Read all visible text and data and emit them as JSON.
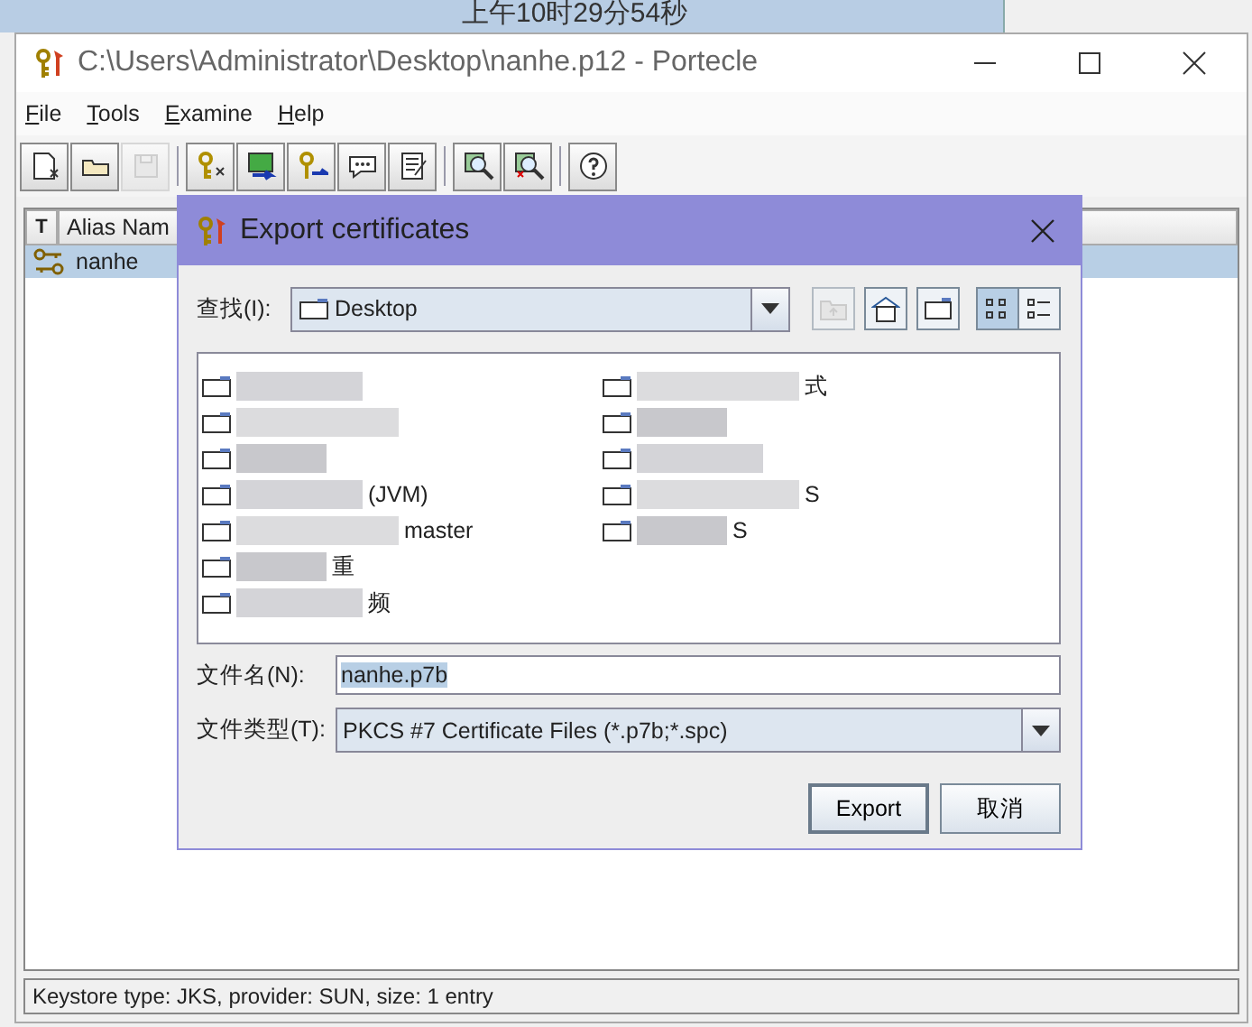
{
  "background_window": {
    "clock_text": "上午10时29分54秒"
  },
  "window": {
    "title": "C:\\Users\\Administrator\\Desktop\\nanhe.p12 - Portecle"
  },
  "menu": [
    {
      "label": "File"
    },
    {
      "label": "Tools"
    },
    {
      "label": "Examine"
    },
    {
      "label": "Help"
    }
  ],
  "toolbar": [
    [
      {
        "kind": "new",
        "disabled": false
      },
      {
        "kind": "open",
        "disabled": false
      },
      {
        "kind": "save",
        "disabled": true
      }
    ],
    [
      {
        "kind": "key",
        "disabled": false
      },
      {
        "kind": "import",
        "disabled": false
      },
      {
        "kind": "keyimport",
        "disabled": false
      },
      {
        "kind": "chat",
        "disabled": false
      },
      {
        "kind": "report",
        "disabled": false
      }
    ],
    [
      {
        "kind": "examine",
        "disabled": false
      },
      {
        "kind": "examinex",
        "disabled": false
      }
    ],
    [
      {
        "kind": "help",
        "disabled": false
      }
    ]
  ],
  "table": {
    "columns": [
      {
        "label": "T"
      },
      {
        "label": "Alias Nam"
      }
    ],
    "rows": [
      {
        "alias": "nanhe",
        "selected": true
      }
    ]
  },
  "dialog": {
    "title": "Export certificates",
    "look_in": {
      "label": "查找(I):",
      "value": "Desktop"
    },
    "nav_buttons": [
      {
        "kind": "up",
        "disabled": true,
        "selected": false
      },
      {
        "kind": "home",
        "disabled": false,
        "selected": false
      },
      {
        "kind": "newfolder",
        "disabled": false,
        "selected": false
      },
      {
        "kind": "list",
        "disabled": false,
        "selected": true
      },
      {
        "kind": "details",
        "disabled": false,
        "selected": false
      }
    ],
    "files": [
      [
        {
          "kind": "folder"
        },
        {
          "kind": "folder"
        },
        {
          "kind": "folder"
        },
        {
          "kind": "folder",
          "text": "(JVM)"
        },
        {
          "kind": "folder",
          "text": "master"
        },
        {
          "kind": "folder",
          "text": "重"
        },
        {
          "kind": "folder",
          "text": "频"
        }
      ],
      [
        {
          "kind": "folder",
          "text": "式"
        },
        {
          "kind": "folder"
        },
        {
          "kind": "folder"
        },
        {
          "kind": "folder",
          "text": "S"
        },
        {
          "kind": "folder",
          "text": "S"
        }
      ]
    ],
    "file_name": {
      "label": "文件名(N):",
      "value": "nanhe.p7b"
    },
    "file_type": {
      "label": "文件类型(T):",
      "value": "PKCS #7 Certificate Files (*.p7b;*.spc)"
    },
    "buttons": [
      {
        "label": "Export",
        "default": true
      },
      {
        "label": "取消",
        "default": false
      }
    ]
  },
  "status_bar": "Keystore type: JKS, provider: SUN, size: 1 entry"
}
